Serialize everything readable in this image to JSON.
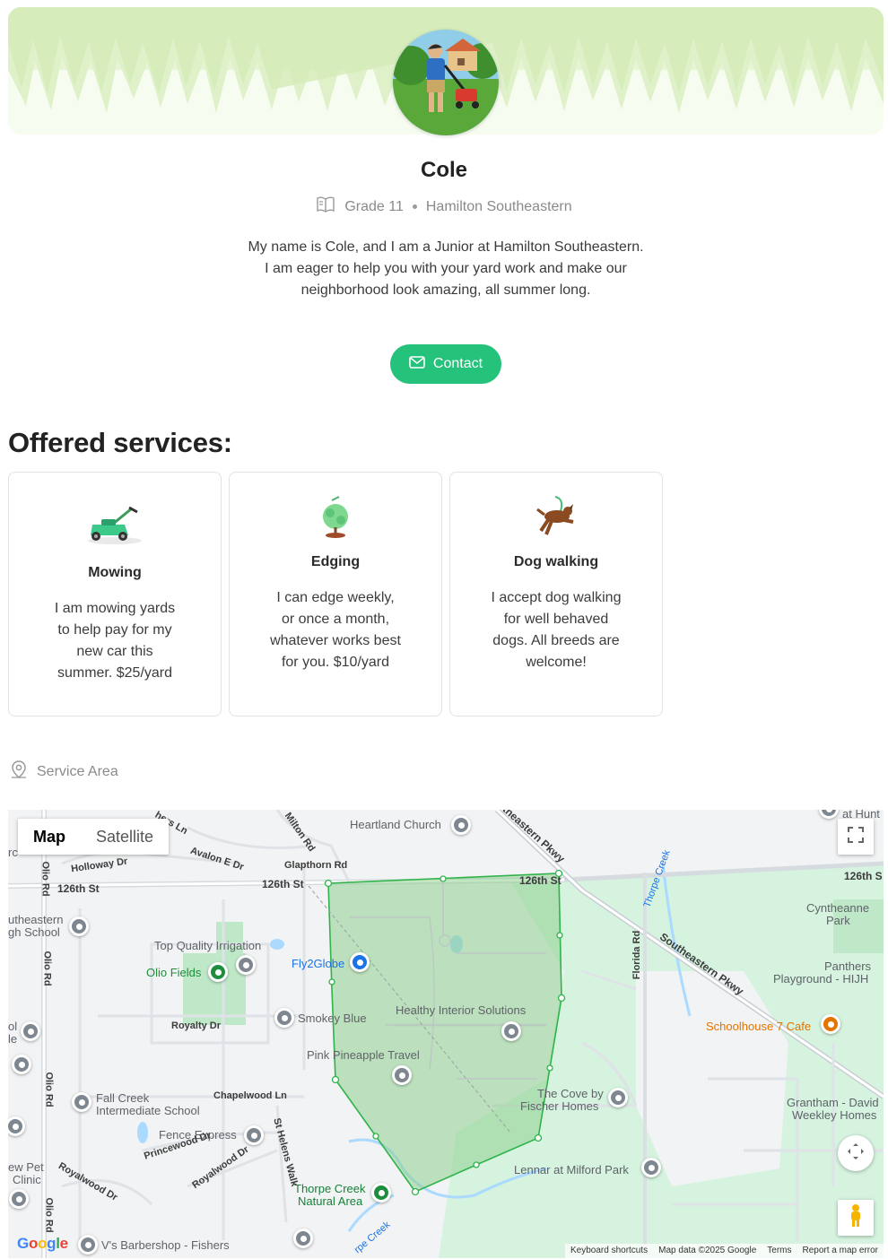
{
  "profile": {
    "name": "Cole",
    "grade": "Grade 11",
    "school": "Hamilton Southeastern",
    "bio": "My name is Cole, and I am a Junior at Hamilton Southeastern. I am eager to help you with your yard work and make our neighborhood look amazing, all summer long.",
    "contact_label": "Contact"
  },
  "services": {
    "heading": "Offered services:",
    "items": [
      {
        "title": "Mowing",
        "description": "I am mowing yards to help pay for my new car this summer. $25/yard",
        "icon": "lawn-mower-icon"
      },
      {
        "title": "Edging",
        "description": "I can edge weekly, or once a month, whatever works best for you. $10/yard",
        "icon": "shrub-icon"
      },
      {
        "title": "Dog walking",
        "description": "I accept dog walking for well behaved dogs. All breeds are welcome!",
        "icon": "dog-icon"
      }
    ]
  },
  "service_area": {
    "label": "Service Area"
  },
  "map": {
    "type_options": [
      "Map",
      "Satellite"
    ],
    "selected_type": "Map",
    "places": {
      "heartland_church": "Heartland Church",
      "top_quality": "Top Quality Irrigation",
      "olio_fields": "Olio Fields",
      "fly2globe": "Fly2Globe",
      "smokey_blue": "Smokey Blue",
      "healthy_interior": "Healthy Interior Solutions",
      "pink_pineapple": "Pink Pineapple Travel",
      "fall_creek_1": "Fall Creek",
      "fall_creek_2": "Intermediate School",
      "fence_express": "Fence Express",
      "thorpe_creek_1": "Thorpe Creek",
      "thorpe_creek_2": "Natural Area",
      "cove_1": "The Cove by",
      "cove_2": "Fischer Homes",
      "lennar": "Lennar at Milford Park",
      "schoolhouse": "Schoolhouse 7 Cafe",
      "cyntheanne_1": "Cyntheanne",
      "cyntheanne_2": "Park",
      "panthers_1": "Panthers",
      "panthers_2": "Playground - HIJH",
      "grantham_1": "Grantham - David",
      "grantham_2": "Weekley Homes",
      "hse_school_1": "utheastern",
      "hse_school_2": "gh School",
      "pet_clinic_1": "ew Pet",
      "pet_clinic_2": "Clinic",
      "barbershop": "V's Barbershop - Fishers",
      "at_hunt": "at Hunt",
      "ol": "ol",
      "le": "le",
      "rc": "rc"
    },
    "roads": {
      "r126_left": "126th St",
      "r126_mid": "126th St",
      "r126_right": "126th St",
      "r126_far": "126th S",
      "holloway": "Holloway Dr",
      "avalon": "Avalon E Dr",
      "milton": "Milton Rd",
      "glapthorn": "Glapthorn Rd",
      "hers_ln": "hers Ln",
      "olio1": "Olio Rd",
      "olio2": "Olio Rd",
      "olio3": "Olio Rd",
      "olio4": "Olio Rd",
      "royalty": "Royalty Dr",
      "chapelwood": "Chapelwood Ln",
      "princewood": "Princewood Dr",
      "royalwood1": "Royalwood Dr",
      "royalwood2": "Royalwood Dr",
      "st_helens": "St Helens Walk",
      "southeastern_top": "theastern Pkwy",
      "southeastern": "Southeastern Pkwy",
      "florida": "Florida Rd",
      "thorpe_creek_river": "Thorpe Creek",
      "rpe_creek": "rpe Creek"
    },
    "footer": [
      "Keyboard shortcuts",
      "Map data ©2025 Google",
      "Terms",
      "Report a map error"
    ],
    "logo": "Google",
    "colors": {
      "area_stroke": "#2fb34a",
      "area_fill": "#8fcf8f",
      "park": "#c8ecd3"
    }
  },
  "colors": {
    "accent": "#24c27a"
  }
}
